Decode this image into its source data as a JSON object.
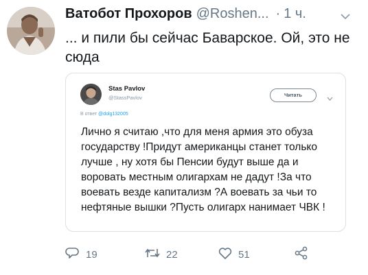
{
  "tweet": {
    "author_name": "Ватобот Прохоров",
    "author_handle": "@Roshen...",
    "separator": "·",
    "time": "1 ч.",
    "text": "... и пили бы сейчас Баварское. Ой, это не сюда"
  },
  "quoted_tweet": {
    "author_name": "Stas Pavlov",
    "author_handle": "@StassPavlov",
    "follow_label": "Читать",
    "reply_prefix": "В ответ",
    "reply_handle": "@dolg132005",
    "text": "Лично я считаю ,что для меня армия это обуза государству !Придут американцы станет только лучше , ну хотя бы  Пенсии будут выше да и воровать местным олигархам не дадут !За что воевать везде капитализм ?А воевать за чьи то нефтяные вышки ?Пусть олигарх нанимает ЧВК !"
  },
  "actions": {
    "replies": "19",
    "retweets": "22",
    "likes": "51"
  },
  "icons": [
    "reply-icon",
    "retweet-icon",
    "like-icon",
    "share-icon",
    "chevron-down-icon"
  ]
}
